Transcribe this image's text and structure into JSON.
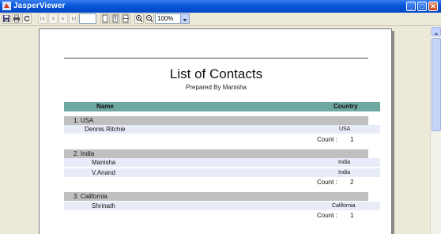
{
  "window": {
    "title": "JasperViewer",
    "minimize_label": "_",
    "maximize_label": "□",
    "close_label": "✕"
  },
  "toolbar": {
    "buttons": [
      "save-icon",
      "print-icon",
      "reload-icon",
      "first-page-icon",
      "previous-page-icon",
      "next-page-icon",
      "last-page-icon",
      "actual-size-icon",
      "fit-page-icon",
      "fit-width-icon",
      "zoom-in-icon",
      "zoom-out-icon"
    ],
    "page_number": "",
    "zoom": "100%"
  },
  "report": {
    "title": "List of Contacts",
    "subtitle": "Prepared By Manisha",
    "columns": {
      "name": "Name",
      "country": "Country"
    },
    "count_label": "Count :",
    "groups": [
      {
        "header": "1. USA",
        "rows": [
          {
            "name": "Dennis Ritchie",
            "country": "USA"
          }
        ],
        "count": "1"
      },
      {
        "header": "2. India",
        "rows": [
          {
            "name": "Manisha",
            "country": "India"
          },
          {
            "name": "V.Anand",
            "country": "India"
          }
        ],
        "count": "2"
      },
      {
        "header": "3. California",
        "rows": [
          {
            "name": "Shrinath",
            "country": "California"
          }
        ],
        "count": "1"
      }
    ]
  },
  "colors": {
    "titlebar": "#0A58D8",
    "column_header": "#6FA7A1",
    "group_header": "#C0C0C0",
    "detail_row": "#E8ECF8"
  }
}
